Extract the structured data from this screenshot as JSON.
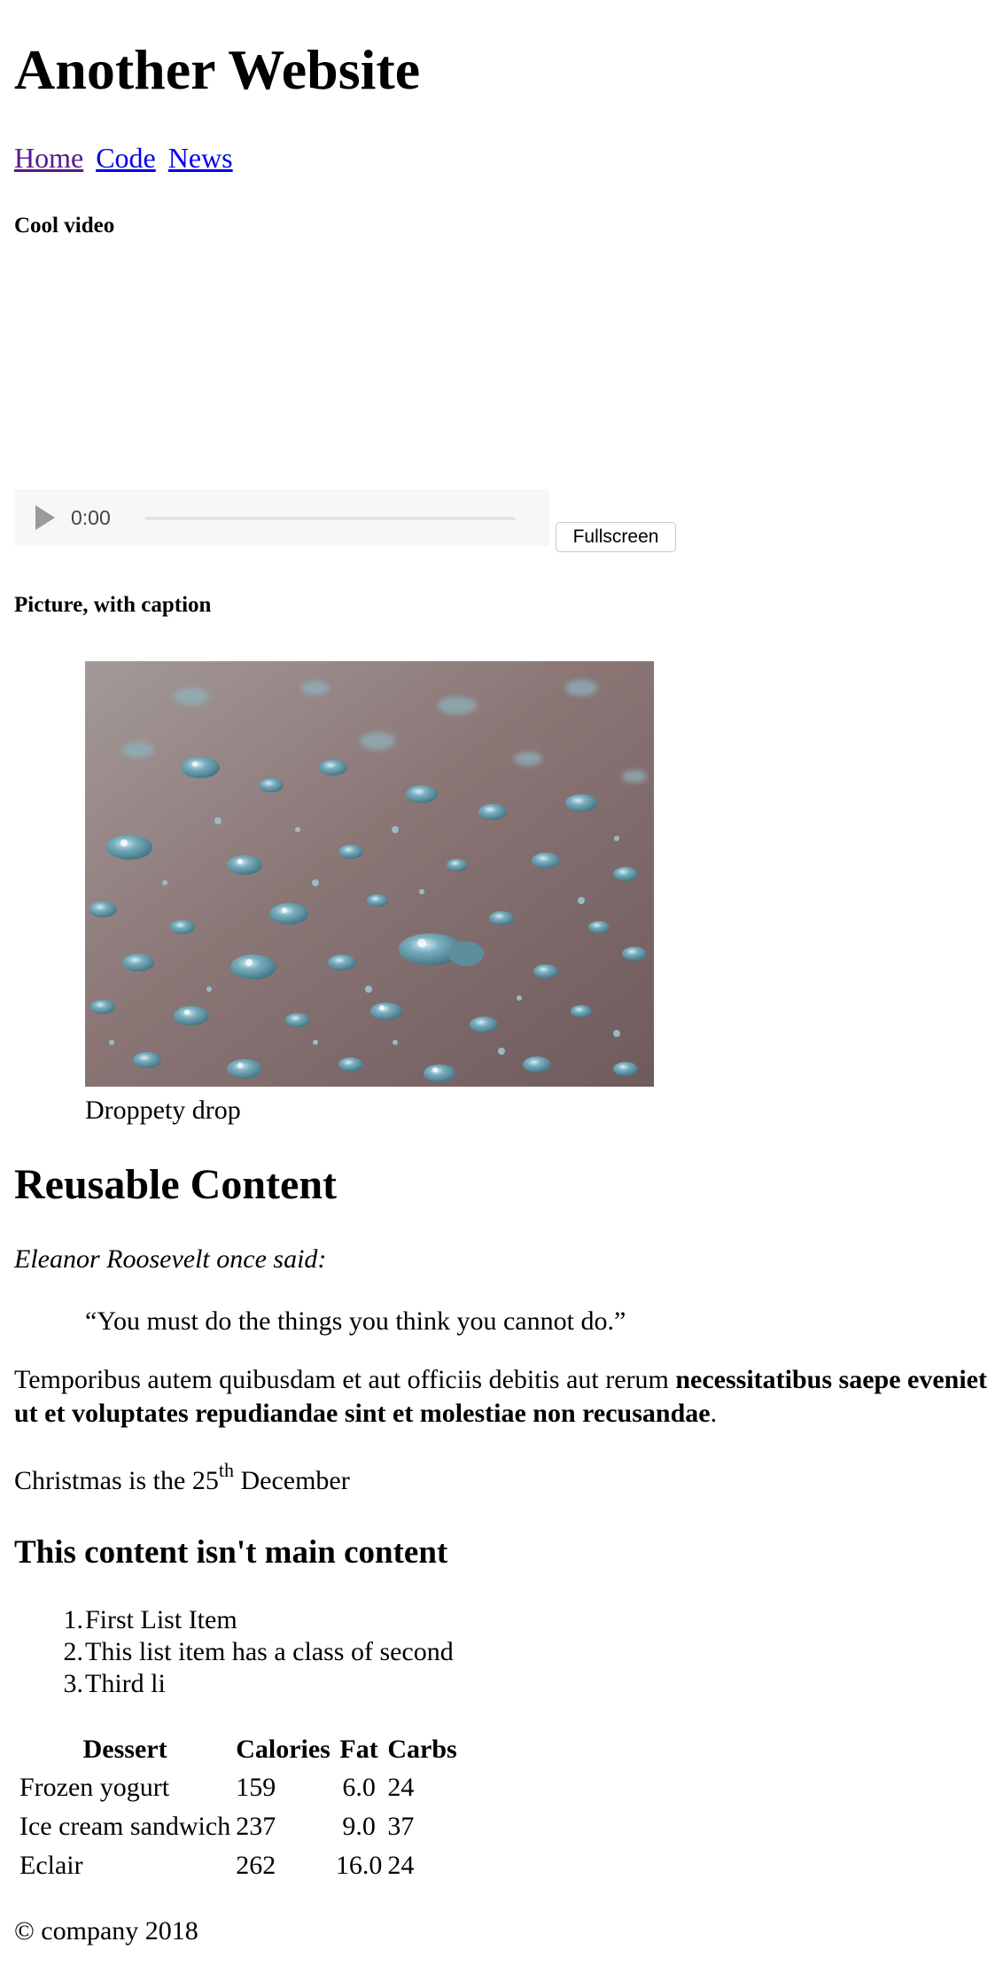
{
  "site": {
    "title": "Another Website"
  },
  "nav": {
    "items": [
      "Home",
      "Code",
      "News"
    ]
  },
  "video_section": {
    "heading": "Cool video",
    "player": {
      "time": "0:00"
    },
    "fullscreen_label": "Fullscreen"
  },
  "picture_section": {
    "heading": "Picture, with caption",
    "caption": "Droppety drop"
  },
  "reusable": {
    "heading": "Reusable Content",
    "attribution": "Eleanor Roosevelt once said:",
    "quote": "“You must do the things you think you cannot do.”",
    "paragraph_plain": "Temporibus autem quibusdam et aut officiis debitis aut rerum ",
    "paragraph_bold": "necessitatibus saepe eveniet ut et voluptates repudiandae sint et molestiae non recusandae",
    "paragraph_end": ".",
    "date_pre": "Christmas is the 25",
    "date_sup": "th",
    "date_post": " December"
  },
  "aside": {
    "heading": "This content isn't main content",
    "list": [
      {
        "num": "1.",
        "text": "First List Item"
      },
      {
        "num": "2.",
        "text": "This list item has a class of second"
      },
      {
        "num": "3.",
        "text": "Third li"
      }
    ]
  },
  "table": {
    "headers": [
      "Dessert",
      "Calories",
      "Fat",
      "Carbs"
    ],
    "rows": [
      [
        "Frozen yogurt",
        "159",
        "6.0",
        "24"
      ],
      [
        "Ice cream sandwich",
        "237",
        "9.0",
        "37"
      ],
      [
        "Eclair",
        "262",
        "16.0",
        "24"
      ]
    ]
  },
  "footer": {
    "text": "© company 2018"
  },
  "colors": {
    "link": "#0000ee",
    "visited_link": "#551a8b"
  },
  "icons": {
    "play": "play-icon",
    "image": "water-droplets-photo"
  }
}
